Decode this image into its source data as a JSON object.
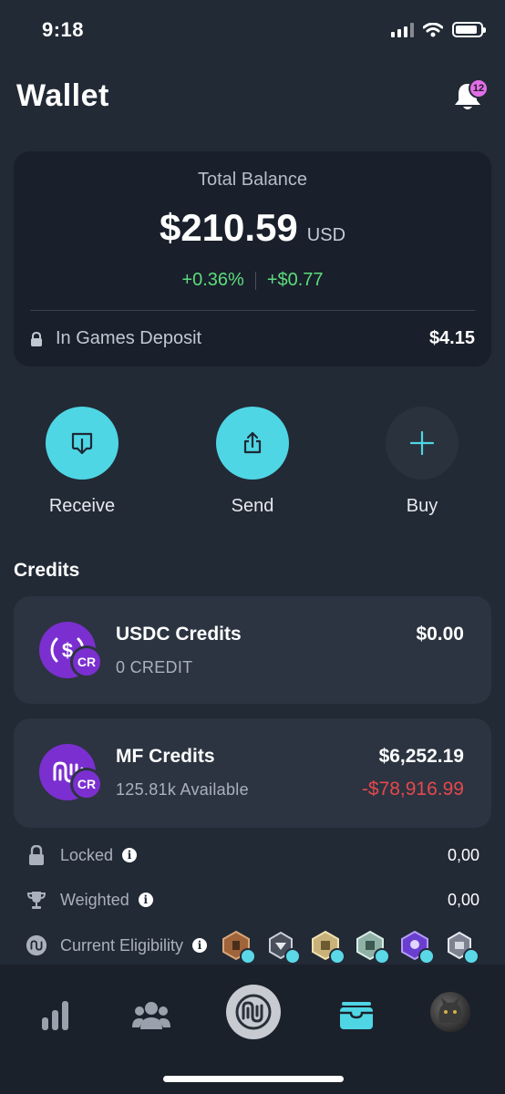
{
  "status_bar": {
    "time": "9:18",
    "battery_level": 0.9
  },
  "header": {
    "title": "Wallet",
    "notification_count": "12"
  },
  "balance": {
    "label": "Total Balance",
    "amount": "$210.59",
    "currency": "USD",
    "change_percent": "+0.36%",
    "change_amount": "+$0.77",
    "deposit_label": "In Games Deposit",
    "deposit_value": "$4.15"
  },
  "actions": [
    {
      "label": "Receive",
      "icon": "receive-icon",
      "color": "#4fd6e4"
    },
    {
      "label": "Send",
      "icon": "send-icon",
      "color": "#4fd6e4"
    },
    {
      "label": "Buy",
      "icon": "plus-icon",
      "color": "#2a323e"
    }
  ],
  "credits": {
    "title": "Credits",
    "items": [
      {
        "name": "USDC Credits",
        "sub": "0 CREDIT",
        "value": "$0.00",
        "change": "",
        "icon": "usdc-coin-icon",
        "badge": "CR"
      },
      {
        "name": "MF Credits",
        "sub": "125.81k Available",
        "value": "$6,252.19",
        "change": "-$78,916.99",
        "icon": "mf-coin-icon",
        "badge": "CR"
      }
    ]
  },
  "stats": {
    "locked": {
      "label": "Locked",
      "value": "0,00"
    },
    "weighted": {
      "label": "Weighted",
      "value": "0,00"
    },
    "eligibility": {
      "label": "Current Eligibility"
    }
  },
  "colors": {
    "accent": "#4fd6e4",
    "positive": "#5ddc7c",
    "negative": "#e5484d",
    "coin": "#7b2fd0"
  },
  "nav": [
    "stats-icon",
    "community-icon",
    "home-logo-icon",
    "wallet-icon",
    "profile-avatar"
  ]
}
